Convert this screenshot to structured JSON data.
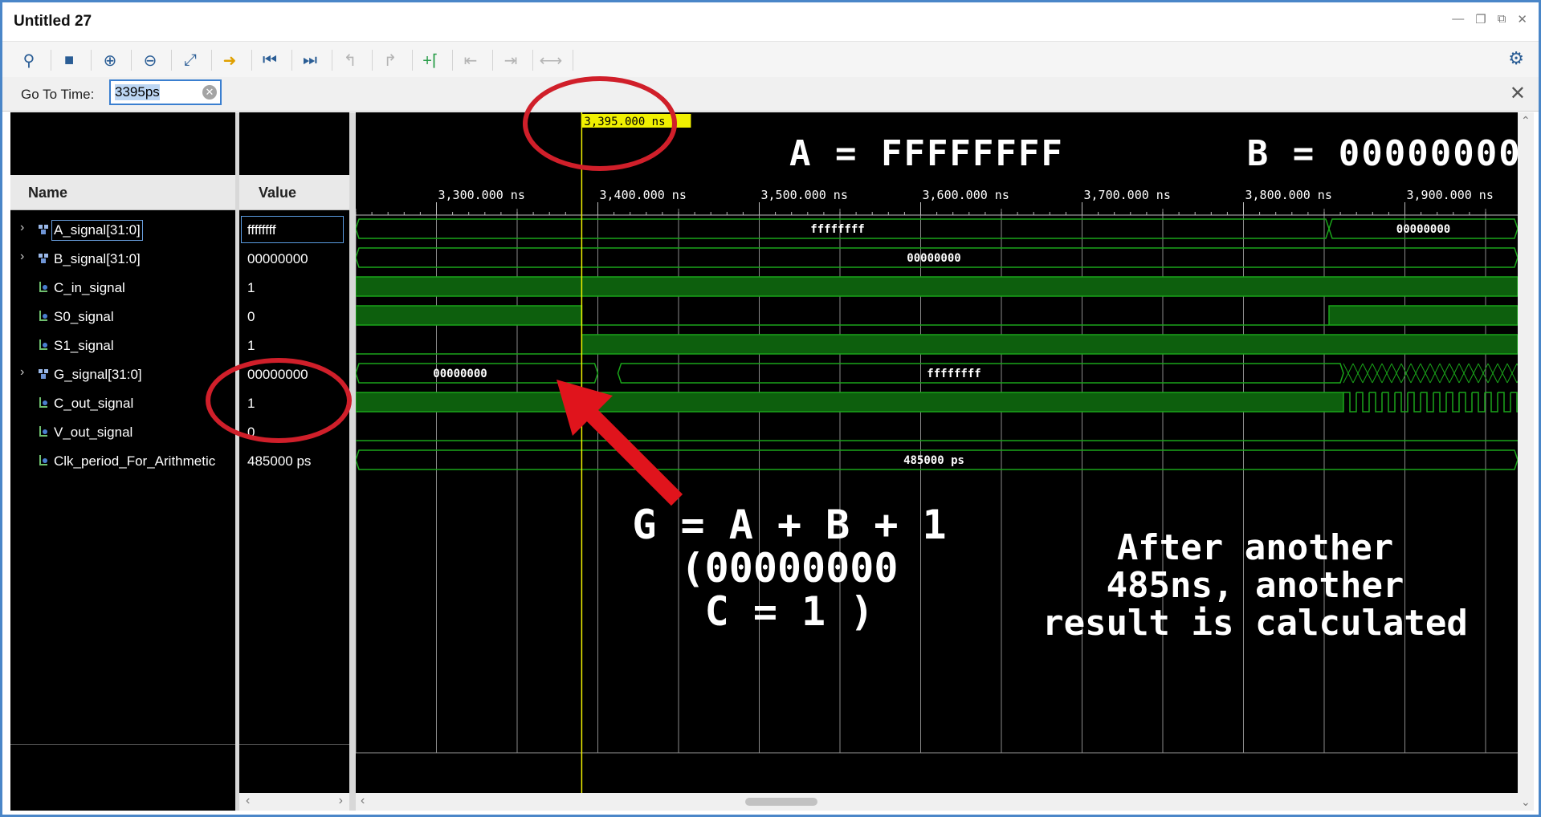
{
  "window": {
    "title": "Untitled 27"
  },
  "toolbar": {
    "buttons": [
      "search-icon",
      "save-icon",
      "zoom-in-icon",
      "zoom-out-icon",
      "zoom-fit-icon",
      "go-to-cursor-icon",
      "go-to-start-icon",
      "go-to-end-icon",
      "previous-transition-icon",
      "next-transition-icon",
      "add-marker-icon",
      "previous-marker-icon",
      "next-marker-icon",
      "swap-cursors-icon"
    ]
  },
  "goto": {
    "label": "Go To Time:",
    "value": "3395ps"
  },
  "columns": {
    "name": "Name",
    "value": "Value"
  },
  "signals": [
    {
      "name": "A_signal[31:0]",
      "value": "ffffffff",
      "bus": true
    },
    {
      "name": "B_signal[31:0]",
      "value": "00000000",
      "bus": true
    },
    {
      "name": "C_in_signal",
      "value": "1",
      "bus": false
    },
    {
      "name": "S0_signal",
      "value": "0",
      "bus": false
    },
    {
      "name": "S1_signal",
      "value": "1",
      "bus": false
    },
    {
      "name": "G_signal[31:0]",
      "value": "00000000",
      "bus": true
    },
    {
      "name": "C_out_signal",
      "value": "1",
      "bus": false
    },
    {
      "name": "V_out_signal",
      "value": "0",
      "bus": false
    },
    {
      "name": "Clk_period_For_Arithmetic",
      "value": "485000 ps",
      "bus": false
    }
  ],
  "waveform": {
    "cursor_label": "3,395.000 ns",
    "time_ticks": [
      "3,300.000 ns",
      "3,400.000 ns",
      "3,500.000 ns",
      "3,600.000 ns",
      "3,700.000 ns",
      "3,800.000 ns",
      "3,900.000 ns"
    ],
    "bus_labels": {
      "a_before": "ffffffff",
      "a_after": "00000000",
      "b": "00000000",
      "g_before": "00000000",
      "g_after": "ffffffff",
      "clk": "485000 ps"
    }
  },
  "annotations": {
    "ab": "A = FFFFFFFF        B = 00000000",
    "g_line1": "G = A + B + 1",
    "g_line2": "(00000000",
    "g_line3": "C = 1 )",
    "after_line1": "After another",
    "after_line2": "485ns, another",
    "after_line3": "result is calculated"
  },
  "colors": {
    "wave": "#1aa51a",
    "cursor": "#f0f000",
    "annotation": "#d01f2a",
    "accent": "#2a5d95"
  }
}
